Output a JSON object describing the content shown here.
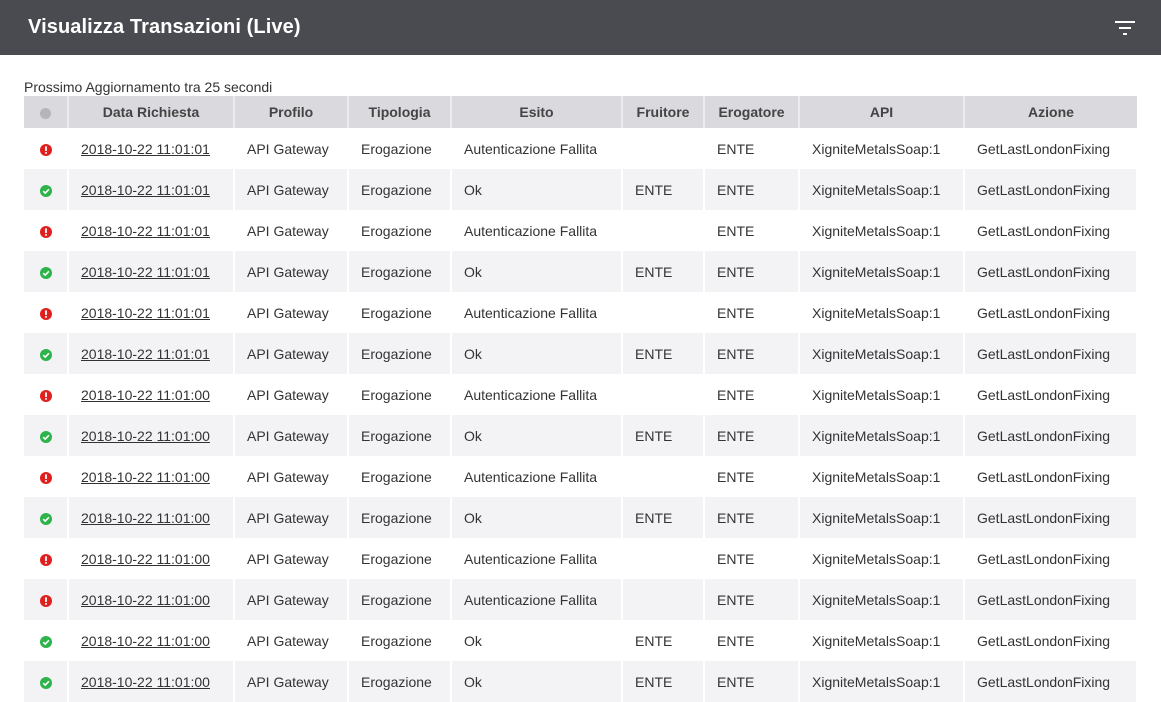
{
  "header": {
    "title": "Visualizza Transazioni (Live)",
    "filter_icon": "filter-icon"
  },
  "refresh_text": "Prossimo Aggiornamento tra 25 secondi",
  "colors": {
    "topbar": "#4a4b51",
    "error": "#e0201e",
    "ok": "#2db34a",
    "header_bg": "#d9d9de"
  },
  "table": {
    "columns": [
      "Data Richiesta",
      "Profilo",
      "Tipologia",
      "Esito",
      "Fruitore",
      "Erogatore",
      "API",
      "Azione"
    ],
    "rows": [
      {
        "status": "error",
        "date": "2018-10-22 11:01:01",
        "profilo": "API Gateway",
        "tipologia": "Erogazione",
        "esito": "Autenticazione Fallita",
        "fruitore": "",
        "erogatore": "ENTE",
        "api": "XigniteMetalsSoap:1",
        "azione": "GetLastLondonFixing"
      },
      {
        "status": "ok",
        "date": "2018-10-22 11:01:01",
        "profilo": "API Gateway",
        "tipologia": "Erogazione",
        "esito": "Ok",
        "fruitore": "ENTE",
        "erogatore": "ENTE",
        "api": "XigniteMetalsSoap:1",
        "azione": "GetLastLondonFixing"
      },
      {
        "status": "error",
        "date": "2018-10-22 11:01:01",
        "profilo": "API Gateway",
        "tipologia": "Erogazione",
        "esito": "Autenticazione Fallita",
        "fruitore": "",
        "erogatore": "ENTE",
        "api": "XigniteMetalsSoap:1",
        "azione": "GetLastLondonFixing"
      },
      {
        "status": "ok",
        "date": "2018-10-22 11:01:01",
        "profilo": "API Gateway",
        "tipologia": "Erogazione",
        "esito": "Ok",
        "fruitore": "ENTE",
        "erogatore": "ENTE",
        "api": "XigniteMetalsSoap:1",
        "azione": "GetLastLondonFixing"
      },
      {
        "status": "error",
        "date": "2018-10-22 11:01:01",
        "profilo": "API Gateway",
        "tipologia": "Erogazione",
        "esito": "Autenticazione Fallita",
        "fruitore": "",
        "erogatore": "ENTE",
        "api": "XigniteMetalsSoap:1",
        "azione": "GetLastLondonFixing"
      },
      {
        "status": "ok",
        "date": "2018-10-22 11:01:01",
        "profilo": "API Gateway",
        "tipologia": "Erogazione",
        "esito": "Ok",
        "fruitore": "ENTE",
        "erogatore": "ENTE",
        "api": "XigniteMetalsSoap:1",
        "azione": "GetLastLondonFixing"
      },
      {
        "status": "error",
        "date": "2018-10-22 11:01:00",
        "profilo": "API Gateway",
        "tipologia": "Erogazione",
        "esito": "Autenticazione Fallita",
        "fruitore": "",
        "erogatore": "ENTE",
        "api": "XigniteMetalsSoap:1",
        "azione": "GetLastLondonFixing"
      },
      {
        "status": "ok",
        "date": "2018-10-22 11:01:00",
        "profilo": "API Gateway",
        "tipologia": "Erogazione",
        "esito": "Ok",
        "fruitore": "ENTE",
        "erogatore": "ENTE",
        "api": "XigniteMetalsSoap:1",
        "azione": "GetLastLondonFixing"
      },
      {
        "status": "error",
        "date": "2018-10-22 11:01:00",
        "profilo": "API Gateway",
        "tipologia": "Erogazione",
        "esito": "Autenticazione Fallita",
        "fruitore": "",
        "erogatore": "ENTE",
        "api": "XigniteMetalsSoap:1",
        "azione": "GetLastLondonFixing"
      },
      {
        "status": "ok",
        "date": "2018-10-22 11:01:00",
        "profilo": "API Gateway",
        "tipologia": "Erogazione",
        "esito": "Ok",
        "fruitore": "ENTE",
        "erogatore": "ENTE",
        "api": "XigniteMetalsSoap:1",
        "azione": "GetLastLondonFixing"
      },
      {
        "status": "error",
        "date": "2018-10-22 11:01:00",
        "profilo": "API Gateway",
        "tipologia": "Erogazione",
        "esito": "Autenticazione Fallita",
        "fruitore": "",
        "erogatore": "ENTE",
        "api": "XigniteMetalsSoap:1",
        "azione": "GetLastLondonFixing"
      },
      {
        "status": "error",
        "date": "2018-10-22 11:01:00",
        "profilo": "API Gateway",
        "tipologia": "Erogazione",
        "esito": "Autenticazione Fallita",
        "fruitore": "",
        "erogatore": "ENTE",
        "api": "XigniteMetalsSoap:1",
        "azione": "GetLastLondonFixing"
      },
      {
        "status": "ok",
        "date": "2018-10-22 11:01:00",
        "profilo": "API Gateway",
        "tipologia": "Erogazione",
        "esito": "Ok",
        "fruitore": "ENTE",
        "erogatore": "ENTE",
        "api": "XigniteMetalsSoap:1",
        "azione": "GetLastLondonFixing"
      },
      {
        "status": "ok",
        "date": "2018-10-22 11:01:00",
        "profilo": "API Gateway",
        "tipologia": "Erogazione",
        "esito": "Ok",
        "fruitore": "ENTE",
        "erogatore": "ENTE",
        "api": "XigniteMetalsSoap:1",
        "azione": "GetLastLondonFixing"
      }
    ]
  }
}
